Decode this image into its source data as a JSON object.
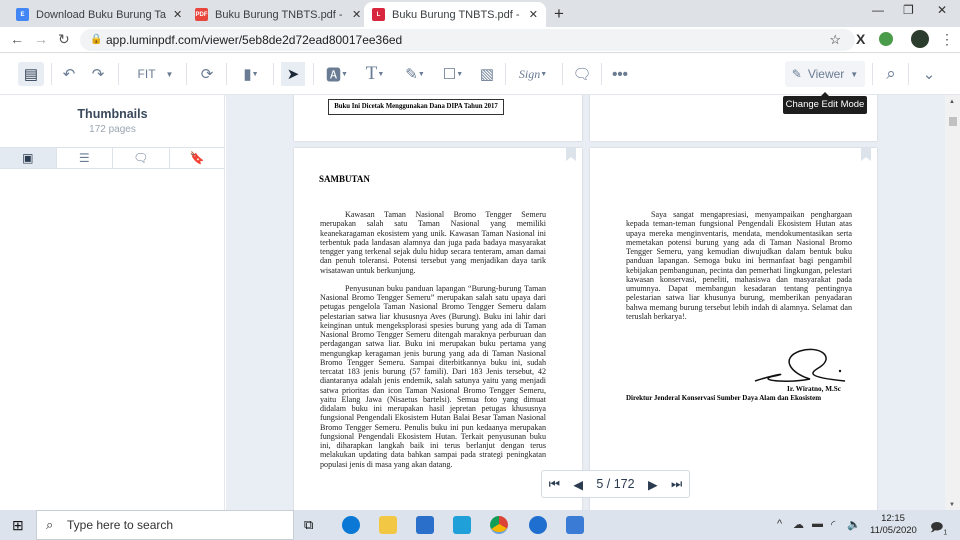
{
  "browser": {
    "tabs": [
      {
        "title": "Download Buku Burung Taman N",
        "icon": "google-docs-icon",
        "color": "#4285f4",
        "glyph": "E"
      },
      {
        "title": "Buku Burung TNBTS.pdf - Google",
        "icon": "pdf-icon",
        "color": "#e8453c",
        "glyph": "PDF"
      },
      {
        "title": "Buku Burung TNBTS.pdf - Lumin",
        "icon": "lumin-icon",
        "color": "#d7263d",
        "glyph": "L",
        "active": true
      }
    ],
    "url": "app.luminpdf.com/viewer/5eb8de2d72ead80017ee36ed"
  },
  "toolbar": {
    "zoom": "FIT",
    "mode": "Viewer",
    "tooltip": "Change Edit Mode",
    "sign": "Sign"
  },
  "sidebar": {
    "title": "Thumbnails",
    "subtitle": "172 pages"
  },
  "document": {
    "top_banner": "Buku Ini Dicetak Menggunakan Dana DIPA Tahun 2017",
    "left_page": {
      "heading": "SAMBUTAN",
      "paragraphs": [
        "Kawasan Taman Nasional Bromo Tengger Semeru merupakan salah satu Taman Nasional yang memiliki keanekaragaman ekosistem yang unik. Kawasan Taman Nasional ini terbentuk pada landasan alamnya dan juga pada badaya masyarakat tengger yang terkenal sejak dulu hidup secara tenteram, aman damai dan penuh toleransi. Potensi tersebut yang menjadikan daya tarik wisatawan untuk berkunjung.",
        "Penyusunan buku panduan lapangan “Burung-burung Taman Nasional Bromo Tengger Semeru” merupakan salah satu upaya dari petugas pengelola Taman Nasional Bromo Tengger Semeru dalam pelestarian satwa liar khususnya Aves (Burung). Buku ini lahir dari keinginan untuk mengeksplorasi spesies burung yang ada di Taman Nasional Bromo Tengger Semeru ditengah maraknya perburuan dan perdagangan satwa liar. Buku ini merupakan buku pertama yang mengungkap keragaman jenis burung yang ada di Taman Nasional Bromo Tengger Semeru. Sampai diterbitkannya buku ini, sudah tercatat 183 jenis burung (57 famili). Dari 183 Jenis tersebut, 42 diantaranya adalah jenis endemik, salah satunya yaitu yang menjadi satwa prioritas dan icon Taman Nasional Bromo Tengger Semeru, yaitu Elang Jawa (Nisaetus bartelsi). Semua foto yang dimuat didalam buku ini merupakan hasil jepretan petugas khususnya fungsional Pengendali Ekosistem Hutan Balai Besar Taman Nasional Bromo Tengger Semeru. Penulis buku ini pun kedaanya merupakan fungsional Pengendali Ekosistem Hutan. Terkait penyusunan buku ini, diharapkan langkah baik ini terus berlanjut dengan terus melakukan updating data bahkan sampai pada strategi peningkatan populasi jenis di masa yang akan datang."
      ]
    },
    "right_page": {
      "paragraph": "Saya sangat mengapresiasi, menyampaikan penghargaan kepada teman-teman fungsional Pengendali Ekosistem Hutan atas upaya mereka menginventaris, mendata, mendokumentasikan serta memetakan potensi burung yang ada di Taman Nasional Bromo Tengger Semeru, yang kemudian diwujudkan dalam bentuk buku panduan lapangan. Semoga buku ini bermanfaat bagi pengambil kebijakan pembangunan, pecinta dan pemerhati lingkungan, pelestari kawasan konservasi, peneliti, mahasiswa dan masyarakat pada umumnya. Dapat membangun kesadaran tentang pentingnya pelestarian satwa liar khusunya burung, memberikan penyadaran bahwa memang burung tersebut lebih indah di alamnya. Selamat dan teruslah berkarya!.",
      "signer": "Ir. Wiratno, M.Sc",
      "signer_title": "Direktur Jenderal Konservasi Sumber Daya Alam dan Ekosistem"
    }
  },
  "pager": {
    "label": "5 / 172"
  },
  "taskbar": {
    "search_placeholder": "Type here to search",
    "time": "12:15",
    "date": "11/05/2020",
    "notifications": "1"
  }
}
